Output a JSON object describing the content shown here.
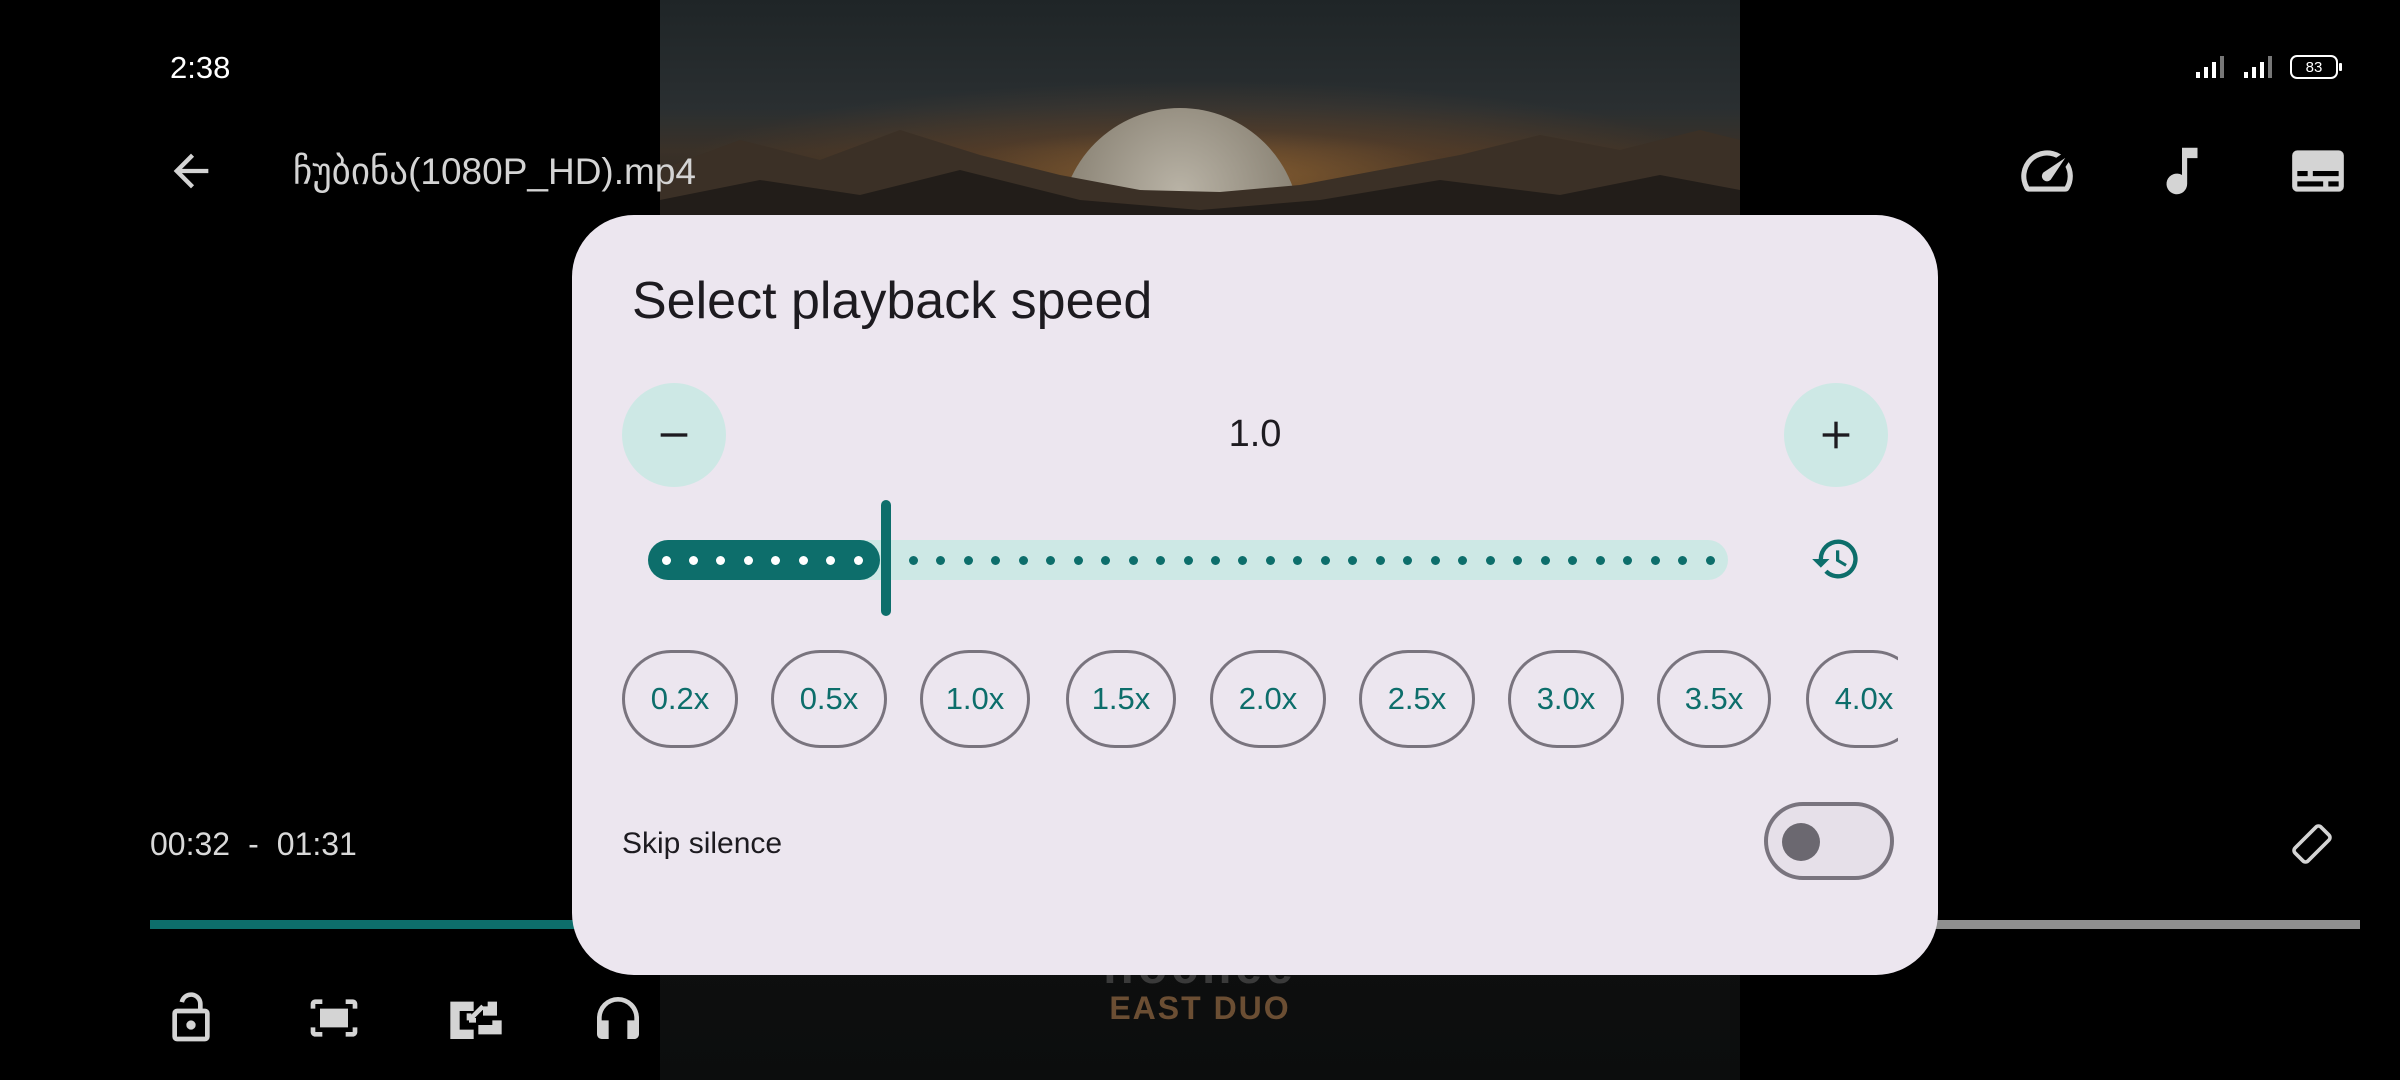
{
  "status_bar": {
    "time": "2:38",
    "battery": "83"
  },
  "top_bar": {
    "title": "ჩუბინა(1080P_HD).mp4"
  },
  "player": {
    "current_time": "00:32",
    "separator": "-",
    "total_time": "01:31",
    "progress_fraction": 0.352
  },
  "video_frame": {
    "visible_text": "EAST DUO",
    "obscured_text": "ilochee"
  },
  "dialog": {
    "title": "Select playback speed",
    "speed_value": "1.0",
    "slider": {
      "min_speed": 0.2,
      "max_speed": 4.0,
      "step": 0.1,
      "value": 1.0
    },
    "presets": [
      "0.2x",
      "0.5x",
      "1.0x",
      "1.5x",
      "2.0x",
      "2.5x",
      "3.0x",
      "3.5x",
      "4.0x"
    ],
    "skip_silence_label": "Skip silence",
    "skip_silence_enabled": false
  },
  "colors": {
    "accent": "#0d6e6b",
    "accent_container": "#cde8e5",
    "dialog_surface": "#ece6ef",
    "outline": "#79747e"
  },
  "icons": {
    "back": "arrow-left-icon",
    "speed": "speedometer-icon",
    "audio": "music-note-icon",
    "subtitles": "subtitles-icon",
    "decrease": "minus-icon",
    "increase": "plus-icon",
    "reset": "history-icon",
    "rotate": "screen-rotation-icon",
    "lock": "lock-open-icon",
    "fit": "fit-screen-icon",
    "pip": "picture-in-picture-icon",
    "background_play": "headphones-icon"
  }
}
